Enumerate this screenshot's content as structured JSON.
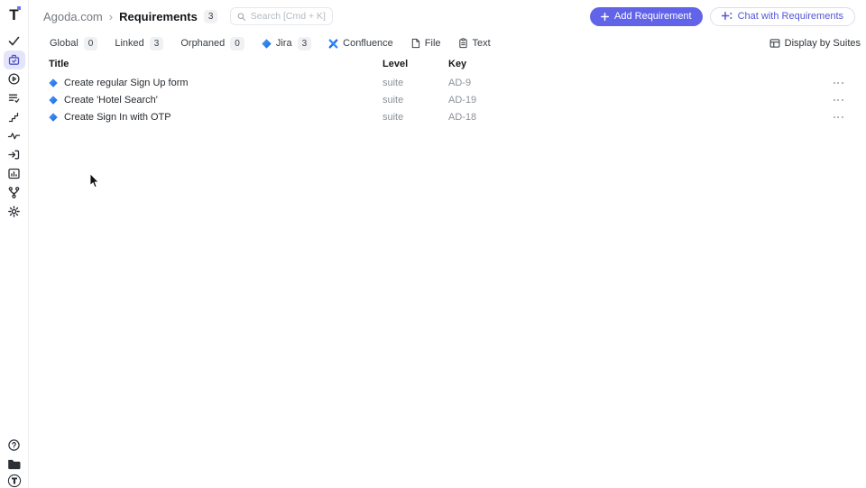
{
  "app": {
    "logo_letter": "T"
  },
  "header": {
    "breadcrumb": {
      "project": "Agoda.com",
      "separator": "›",
      "page": "Requirements",
      "count": "3"
    },
    "search": {
      "placeholder": "Search [Cmd + K]"
    },
    "add_button": "Add Requirement",
    "chat_button": "Chat with Requirements"
  },
  "filters": {
    "items": [
      {
        "label": "Global",
        "count": "0"
      },
      {
        "label": "Linked",
        "count": "3"
      },
      {
        "label": "Orphaned",
        "count": "0"
      },
      {
        "label": "Jira",
        "count": "3",
        "icon": "jira-icon"
      },
      {
        "label": "Confluence",
        "icon": "confluence-icon"
      },
      {
        "label": "File",
        "icon": "file-icon"
      },
      {
        "label": "Text",
        "icon": "text-icon"
      }
    ],
    "display_toggle": "Display by Suites"
  },
  "table": {
    "columns": {
      "title": "Title",
      "level": "Level",
      "key": "Key"
    },
    "rows": [
      {
        "icon": "jira-icon",
        "title": "Create regular Sign Up form",
        "level": "suite",
        "key": "AD-9"
      },
      {
        "icon": "jira-icon",
        "title": "Create 'Hotel Search'",
        "level": "suite",
        "key": "AD-19"
      },
      {
        "icon": "jira-icon",
        "title": "Create Sign In with OTP",
        "level": "suite",
        "key": "AD-18"
      }
    ]
  },
  "sidebar": {
    "icons": [
      "tests-icon",
      "requirements-icon",
      "runs-icon",
      "test-plans-icon",
      "milestones-icon",
      "pulse-icon",
      "import-icon",
      "analytics-icon",
      "branches-icon",
      "settings-icon"
    ],
    "active_icon": "requirements-icon",
    "bottom_icons": [
      "help-icon",
      "projects-folder-icon",
      "profile-avatar"
    ]
  },
  "colors": {
    "accent": "#6163e8",
    "accent_light_bg": "#e4e4fb",
    "jira_blue": "#2684ff",
    "confluence_blue": "#1f6fe0",
    "badge_bg": "#f0f1f3",
    "muted_text": "#8b9198"
  }
}
